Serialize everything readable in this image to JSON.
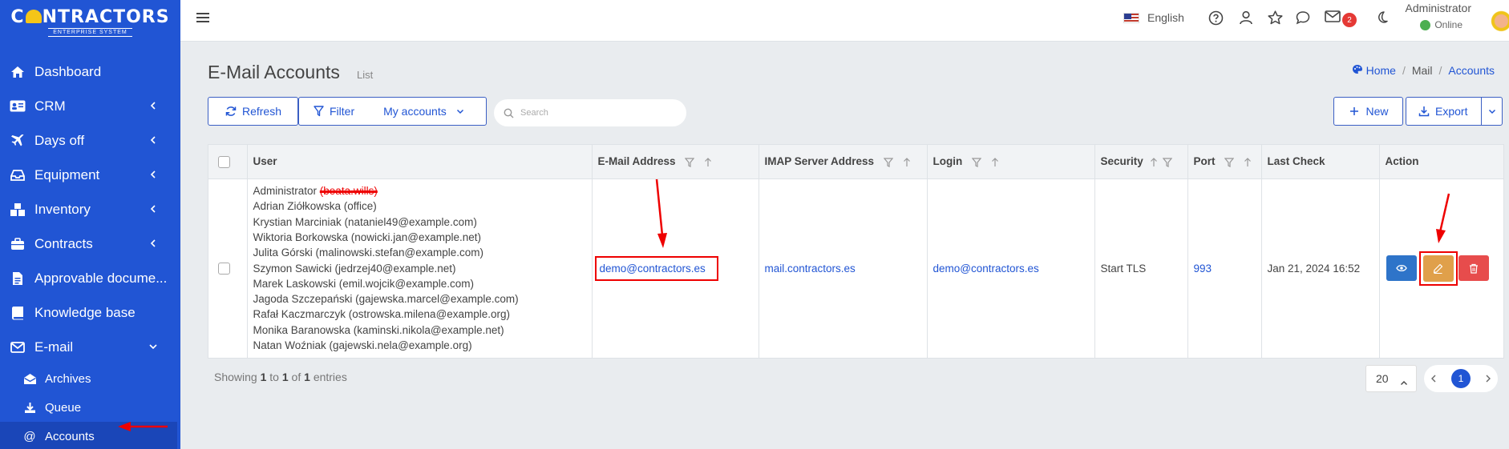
{
  "brand": {
    "name": "CONTRACTORS",
    "tagline": "ENTERPRISE SYSTEM"
  },
  "sidebar": {
    "items": [
      {
        "label": "Dashboard",
        "icon": "home-icon"
      },
      {
        "label": "CRM",
        "icon": "id-card-icon"
      },
      {
        "label": "Days off",
        "icon": "plane-icon"
      },
      {
        "label": "Equipment",
        "icon": "tray-icon"
      },
      {
        "label": "Inventory",
        "icon": "boxes-icon"
      },
      {
        "label": "Contracts",
        "icon": "briefcase-icon"
      },
      {
        "label": "Approvable docume...",
        "icon": "document-icon"
      },
      {
        "label": "Knowledge base",
        "icon": "book-icon"
      },
      {
        "label": "E-mail",
        "icon": "envelope-icon"
      }
    ],
    "email_sub": [
      {
        "label": "Archives",
        "icon": "envelope-open-icon"
      },
      {
        "label": "Queue",
        "icon": "download-icon"
      },
      {
        "label": "Accounts",
        "icon": "at-icon"
      }
    ]
  },
  "topbar": {
    "language": "English",
    "mail_count": "2",
    "user_name": "Administrator",
    "user_status": "Online"
  },
  "page": {
    "title": "E-Mail Accounts",
    "subtitle": "List",
    "breadcrumb": [
      "Home",
      "Mail",
      "Accounts"
    ]
  },
  "toolbar": {
    "refresh": "Refresh",
    "filter": "Filter",
    "my_accounts": "My accounts",
    "search_placeholder": "Search",
    "new": "New",
    "export": "Export"
  },
  "table": {
    "columns": [
      "User",
      "E-Mail Address",
      "IMAP Server Address",
      "Login",
      "Security",
      "Port",
      "Last Check",
      "Action"
    ],
    "rows": [
      {
        "users": [
          {
            "name": "Administrator",
            "extra": "(beata.wills)"
          },
          {
            "name": "Adrian Ziółkowska (office)"
          },
          {
            "name": "Krystian Marciniak (nataniel49@example.com)"
          },
          {
            "name": "Wiktoria Borkowska (nowicki.jan@example.net)"
          },
          {
            "name": "Julita Górski (malinowski.stefan@example.com)"
          },
          {
            "name": "Szymon Sawicki (jedrzej40@example.net)"
          },
          {
            "name": "Marek Laskowski (emil.wojcik@example.com)"
          },
          {
            "name": "Jagoda Szczepański (gajewska.marcel@example.com)"
          },
          {
            "name": "Rafał Kaczmarczyk (ostrowska.milena@example.org)"
          },
          {
            "name": "Monika Baranowska (kaminski.nikola@example.net)"
          },
          {
            "name": "Natan Woźniak (gajewski.nela@example.org)"
          }
        ],
        "email": "demo@contractors.es",
        "imap": "mail.contractors.es",
        "login": "demo@contractors.es",
        "security": "Start TLS",
        "port": "993",
        "last_check": "Jan 21, 2024 16:52"
      }
    ]
  },
  "footer": {
    "showing_prefix": "Showing",
    "from": "1",
    "to_word": "to",
    "to": "1",
    "of_word": "of",
    "total": "1",
    "entries_word": "entries",
    "per_page": "20",
    "current_page": "1"
  },
  "colors": {
    "sidebar": "#2155d4",
    "accent": "#2155d4",
    "annotation": "#e00000"
  }
}
